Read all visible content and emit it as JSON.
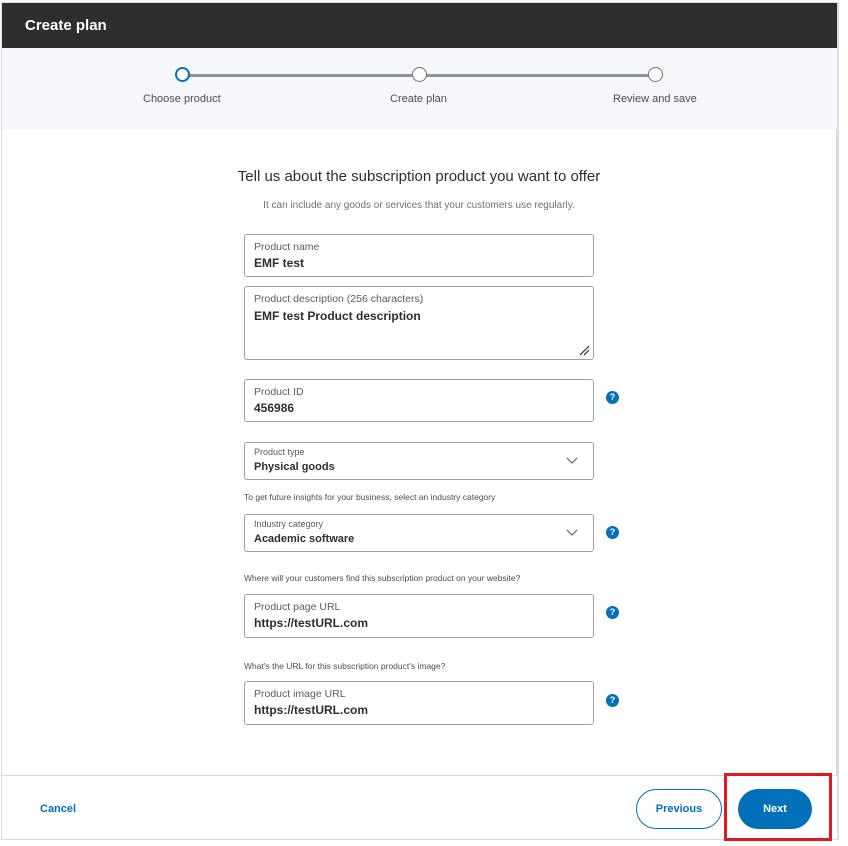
{
  "header": {
    "title": "Create plan"
  },
  "stepper": {
    "steps": [
      {
        "label": "Choose product",
        "active": true
      },
      {
        "label": "Create plan",
        "active": false
      },
      {
        "label": "Review and save",
        "active": false
      }
    ]
  },
  "intro": {
    "title": "Tell us about the subscription product you want to offer",
    "subtitle": "It can include any goods or services that your customers use regularly."
  },
  "form": {
    "product_name": {
      "label": "Product name",
      "value": "EMF test"
    },
    "product_description": {
      "label": "Product description (256 characters)",
      "value": "EMF test Product description"
    },
    "product_id": {
      "label": "Product ID",
      "value": "456986"
    },
    "product_type": {
      "label": "Product type",
      "value": "Physical goods"
    },
    "industry_hint": "To get future insights for your business, select an industry category",
    "industry_category": {
      "label": "Industry category",
      "value": "Academic software"
    },
    "page_url_hint": "Where will your customers find this subscription product on your website?",
    "product_page_url": {
      "label": "Product page URL",
      "value": "https://testURL.com"
    },
    "image_url_hint": "What's the URL for this subscription product's image?",
    "product_image_url": {
      "label": "Product image URL",
      "value": "https://testURL.com"
    },
    "help_glyph": "?"
  },
  "footer": {
    "cancel_label": "Cancel",
    "previous_label": "Previous",
    "next_label": "Next"
  },
  "colors": {
    "accent": "#0070ba",
    "header_bg": "#2c2e2f",
    "highlight": "#e0191f"
  },
  "icons": [
    "chevron-down-icon",
    "help-icon",
    "resize-handle-icon"
  ]
}
